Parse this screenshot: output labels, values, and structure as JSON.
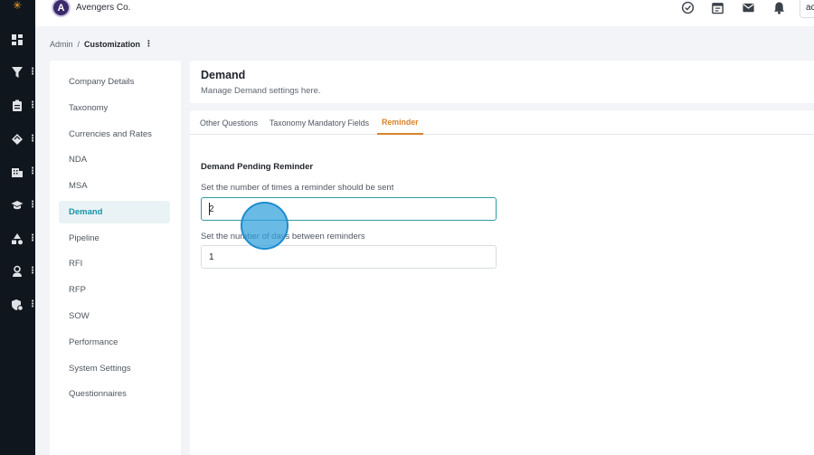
{
  "app": {
    "brand_initial": "A",
    "brand_name": "Avengers Co.",
    "user_chip": "ac"
  },
  "rail": {
    "logo_glyph": "✳",
    "items": [
      {
        "icon": "dashboard-icon",
        "has_menu": false,
        "menu_glyph": ""
      },
      {
        "icon": "filter-icon",
        "has_menu": true,
        "menu_glyph": "⋮"
      },
      {
        "icon": "clipboard-icon",
        "has_menu": true,
        "menu_glyph": "⋮"
      },
      {
        "icon": "tag-icon",
        "has_menu": true,
        "menu_glyph": "⋮"
      },
      {
        "icon": "building-icon",
        "has_menu": true,
        "menu_glyph": "⋮"
      },
      {
        "icon": "graduation-cap-icon",
        "has_menu": true,
        "menu_glyph": "⋮"
      },
      {
        "icon": "shapes-icon",
        "has_menu": true,
        "menu_glyph": "⋮"
      },
      {
        "icon": "user-icon",
        "has_menu": true,
        "menu_glyph": "⋮"
      },
      {
        "icon": "shield-gear-icon",
        "has_menu": true,
        "menu_glyph": "⋮"
      }
    ]
  },
  "topbar_icons": [
    "check-circle-icon",
    "calendar-icon",
    "mail-icon",
    "bell-icon"
  ],
  "breadcrumb": {
    "root": "Admin",
    "separator": "/",
    "current": "Customization",
    "kebab": "⋮"
  },
  "settings_nav": {
    "active": "Demand",
    "items": [
      "Company Details",
      "Taxonomy",
      "Currencies and Rates",
      "NDA",
      "MSA",
      "Demand",
      "Pipeline",
      "RFI",
      "RFP",
      "SOW",
      "Performance",
      "System Settings",
      "Questionnaires"
    ]
  },
  "main": {
    "title": "Demand",
    "subtitle": "Manage Demand settings here.",
    "tabs": [
      "Other Questions",
      "Taxonomy Mandatory Fields",
      "Reminder"
    ],
    "active_tab": "Reminder",
    "section_title": "Demand Pending Reminder",
    "fields": [
      {
        "label": "Set the number of times a reminder should be sent",
        "value": "2",
        "focused": true
      },
      {
        "label": "Set the number of days between reminders",
        "value": "1",
        "focused": false
      }
    ]
  },
  "colors": {
    "rail_bg": "#10161e",
    "accent_teal": "#1a93a8",
    "accent_orange": "#d9822b",
    "page_bg": "#f2f4f7",
    "cursor_overlay": "#31a0dc"
  }
}
